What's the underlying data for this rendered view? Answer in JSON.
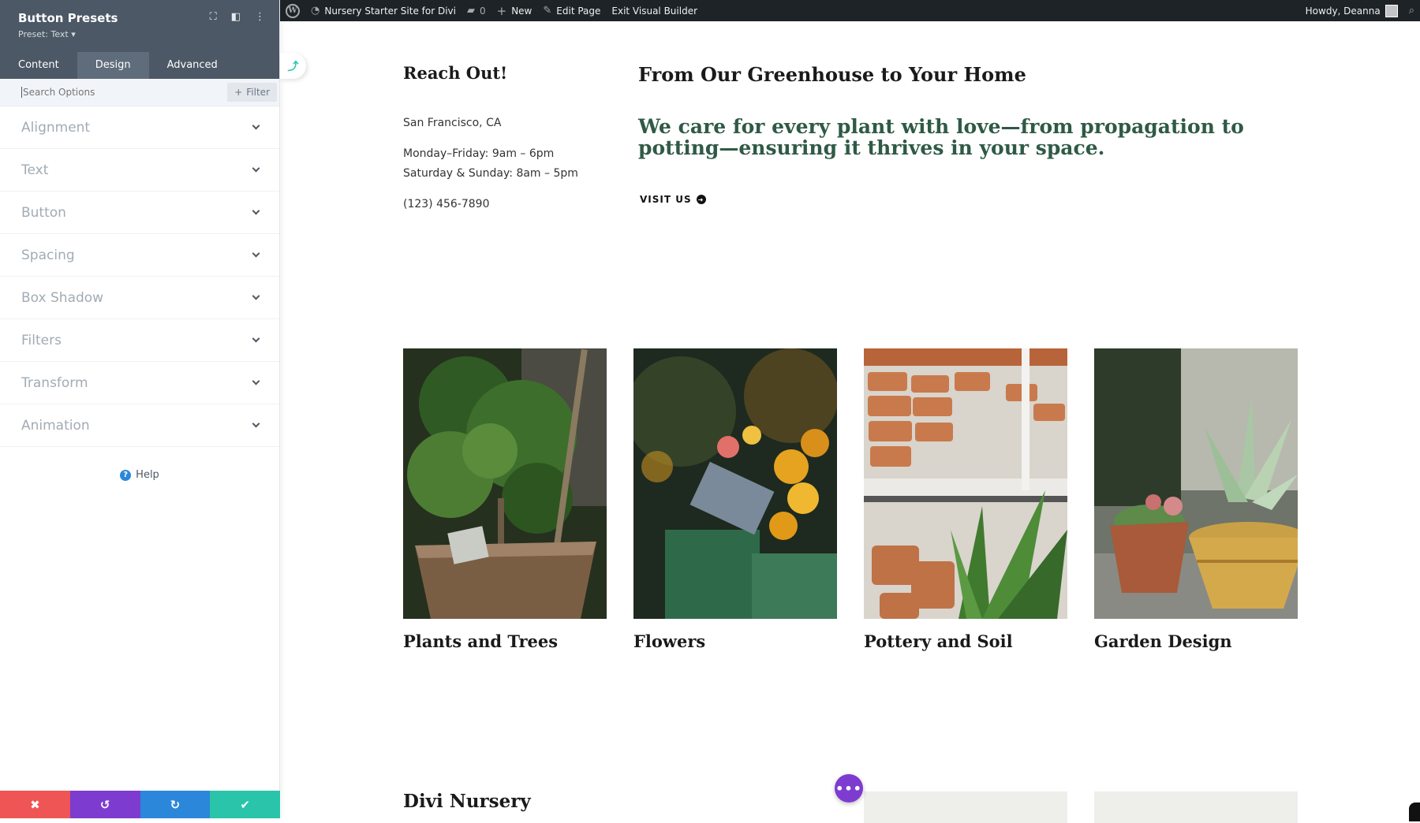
{
  "admin_bar": {
    "site_name": "Nursery Starter Site for Divi",
    "comments_count": "0",
    "new_label": "New",
    "edit_page_label": "Edit Page",
    "exit_vb_label": "Exit Visual Builder",
    "greeting": "Howdy, Deanna"
  },
  "panel": {
    "title": "Button Presets",
    "preset_label": "Preset: Text ▾",
    "tabs": [
      {
        "label": "Content",
        "active": false
      },
      {
        "label": "Design",
        "active": true
      },
      {
        "label": "Advanced",
        "active": false
      }
    ],
    "search_placeholder": "Search Options",
    "filter_label": "Filter",
    "groups": [
      "Alignment",
      "Text",
      "Button",
      "Spacing",
      "Box Shadow",
      "Filters",
      "Transform",
      "Animation"
    ],
    "help_label": "Help"
  },
  "page": {
    "reach_title": "Reach Out!",
    "address": "San Francisco, CA",
    "hours_weekday": "Monday–Friday: 9am – 6pm",
    "hours_weekend": "Saturday & Sunday: 8am – 5pm",
    "phone": "(123) 456-7890",
    "hero_title": "From Our Greenhouse to Your Home",
    "hero_text": "We care for every plant with love—from propagation to potting—ensuring it thrives in your space.",
    "visit_label": "VISIT US",
    "cards": [
      {
        "caption": "Plants and Trees"
      },
      {
        "caption": "Flowers"
      },
      {
        "caption": "Pottery and Soil"
      },
      {
        "caption": "Garden Design"
      }
    ],
    "nursery_title": "Divi Nursery"
  },
  "colors": {
    "panel_header": "#4c5866",
    "accent_teal": "#29c4a9",
    "accent_purple": "#7e3bd0",
    "accent_blue": "#2b87da",
    "accent_red": "#ef5555",
    "hero_green": "#2f5a46"
  }
}
